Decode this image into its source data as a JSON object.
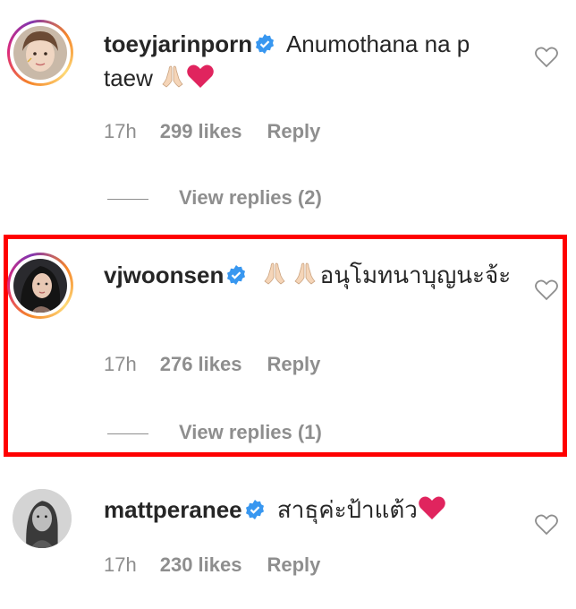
{
  "comments": [
    {
      "username": "toeyjarinporn",
      "text": "Anumothana na p taew",
      "time": "17h",
      "likes": "299 likes",
      "reply": "Reply",
      "view_replies": "View replies (2)"
    },
    {
      "username": "vjwoonsen",
      "text": "อนุโมทนาบุญนะจ้ะ",
      "time": "17h",
      "likes": "276 likes",
      "reply": "Reply",
      "view_replies": "View replies (1)"
    },
    {
      "username": "mattperanee",
      "text": "สาธุค่ะป้าแต้ว",
      "time": "17h",
      "likes": "230 likes",
      "reply": "Reply"
    }
  ],
  "colors": {
    "highlight": "#ff0000",
    "verified": "#3897f0",
    "muted": "#8e8e8e",
    "heart_emoji": "#e0245e"
  }
}
